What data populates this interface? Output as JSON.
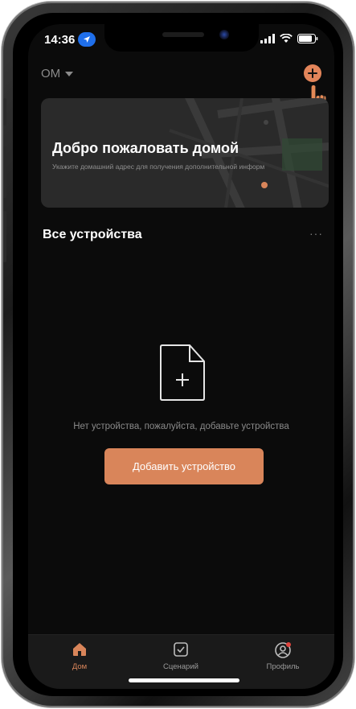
{
  "status_bar": {
    "time": "14:36"
  },
  "header": {
    "home_name": "OM"
  },
  "welcome_card": {
    "title": "Добро пожаловать домой",
    "subtitle": "Укажите домашний адрес для получения дополнительной информ"
  },
  "devices_section": {
    "title": "Все устройства",
    "more_label": "···"
  },
  "empty_state": {
    "message": "Нет устройства, пожалуйста, добавьте устройства",
    "add_button_label": "Добавить устройство"
  },
  "tab_bar": {
    "tabs": [
      {
        "label": "Дом",
        "icon": "home-icon",
        "active": true
      },
      {
        "label": "Сценарий",
        "icon": "checkbox-icon",
        "active": false
      },
      {
        "label": "Профиль",
        "icon": "profile-icon",
        "active": false,
        "badge": true
      }
    ]
  },
  "colors": {
    "accent": "#d9855a",
    "background": "#0b0b0b",
    "card": "#2a2a2a",
    "tab_bar": "#1a1a1a",
    "muted_text": "#8a8a8a"
  }
}
